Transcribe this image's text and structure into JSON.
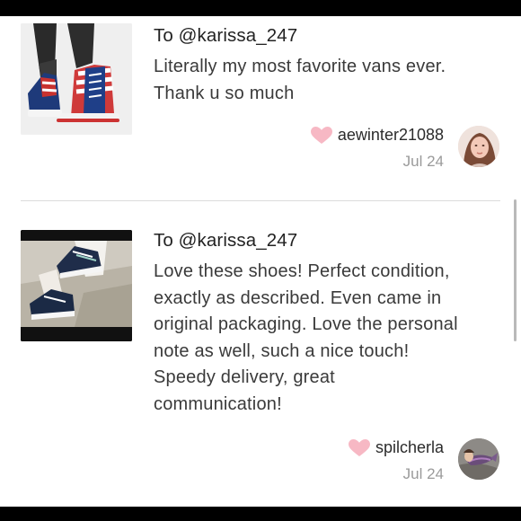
{
  "reviews": [
    {
      "to": "To @karissa_247",
      "text_lines": [
        "Literally my most favorite vans ever.",
        "Thank u so much"
      ],
      "reviewer": "aewinter21088",
      "date": "Jul 24",
      "thumbnail": "red-white-blue-hightop-vans-photo",
      "avatar": "woman-portrait-avatar"
    },
    {
      "to": "To @karissa_247",
      "text_lines": [
        "Love these shoes! Perfect condition,",
        "exactly as described. Even came in",
        "original packaging. Love the personal",
        "note as well, such a nice touch!",
        "Speedy delivery, great",
        "communication!"
      ],
      "reviewer": "spilcherla",
      "date": "Jul 24",
      "thumbnail": "navy-white-lowtop-vans-photo",
      "avatar": "mermaid-tail-avatar"
    }
  ],
  "colors": {
    "heart": "#f7b8c4",
    "divider": "#dcdcdc",
    "date": "#9a9a9a"
  },
  "icons": [
    "heart-icon"
  ]
}
